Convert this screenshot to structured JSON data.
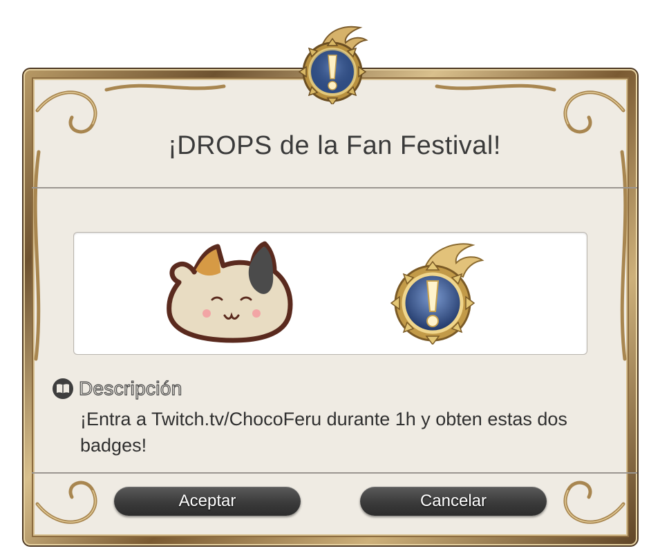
{
  "dialog": {
    "title": "¡DROPS de la Fan Festival!",
    "description_label": "Descripción",
    "description_text": "¡Entra a Twitch.tv/ChocoFeru durante 1h y obten estas dos badges!",
    "buttons": {
      "accept": "Aceptar",
      "cancel": "Cancelar"
    },
    "icons": {
      "top_emblem": "exclamation-emblem-icon",
      "description": "book-icon",
      "badge_1": "fat-cat-badge-icon",
      "badge_2": "exclamation-emblem-icon"
    }
  },
  "colors": {
    "panel_bg": "#efebe3",
    "frame_gold": "#b89a66",
    "button_dark": "#3b3b3b",
    "emblem_blue": "#2f4e86"
  }
}
